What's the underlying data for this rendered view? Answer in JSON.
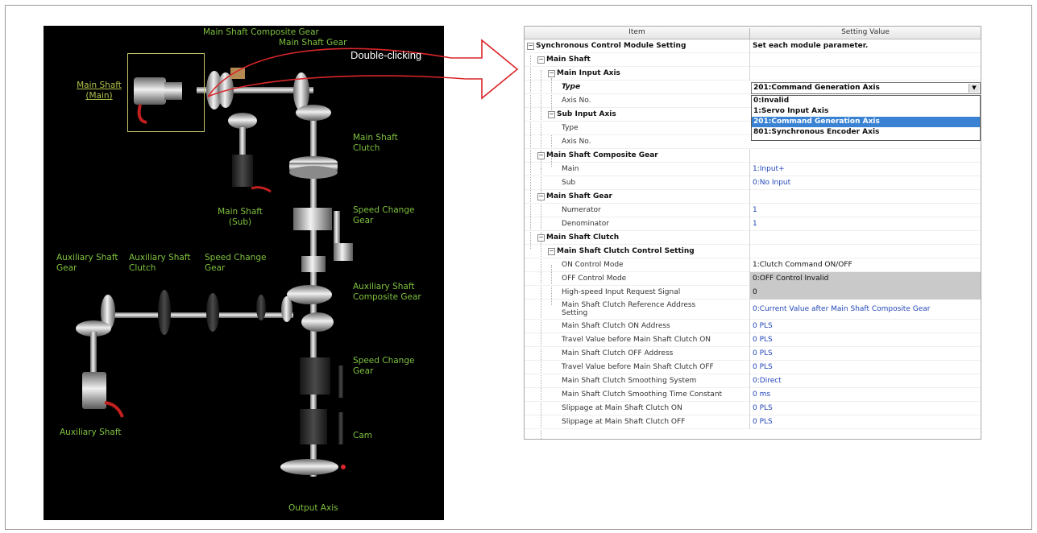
{
  "diagram": {
    "labels": {
      "main_shaft_composite_gear": "Main Shaft Composite Gear",
      "main_shaft_gear": "Main Shaft Gear",
      "main_shaft_main": "Main Shaft (Main)",
      "main_shaft_clutch": "Main Shaft Clutch",
      "main_shaft_sub": "Main Shaft (Sub)",
      "speed_change_gear_1": "Speed Change Gear",
      "auxiliary_shaft_gear": "Auxiliary Shaft Gear",
      "auxiliary_shaft_clutch": "Auxiliary Shaft Clutch",
      "speed_change_gear_aux": "Speed Change Gear",
      "auxiliary_shaft_composite_gear": "Auxiliary Shaft Composite Gear",
      "speed_change_gear_2": "Speed Change Gear",
      "auxiliary_shaft": "Auxiliary Shaft",
      "cam": "Cam",
      "output_axis": "Output Axis"
    },
    "colors": {
      "background": "#000000",
      "label": "#7fc23f",
      "arrow": "#d9262a"
    }
  },
  "callout": {
    "label": "Double-clicking"
  },
  "table": {
    "headers": {
      "item": "Item",
      "value": "Setting Value"
    },
    "rows": [
      {
        "item": "Synchronous Control Module Setting",
        "value": "Set each module parameter."
      },
      {
        "item": "Main Shaft",
        "value": ""
      },
      {
        "item": "Main Input Axis",
        "value": ""
      },
      {
        "item": "Type",
        "value": ""
      },
      {
        "item": "Axis No.",
        "value": ""
      },
      {
        "item": "Sub Input Axis",
        "value": ""
      },
      {
        "item": "Type",
        "value": ""
      },
      {
        "item": "Axis No.",
        "value": ""
      },
      {
        "item": "Main Shaft Composite Gear",
        "value": ""
      },
      {
        "item": "Main",
        "value": "1:Input+"
      },
      {
        "item": "Sub",
        "value": "0:No Input"
      },
      {
        "item": "Main Shaft Gear",
        "value": ""
      },
      {
        "item": "Numerator",
        "value": "1"
      },
      {
        "item": "Denominator",
        "value": "1"
      },
      {
        "item": "Main Shaft Clutch",
        "value": ""
      },
      {
        "item": "Main Shaft Clutch Control Setting",
        "value": ""
      },
      {
        "item": "ON Control Mode",
        "value": "1:Clutch Command ON/OFF"
      },
      {
        "item": "OFF Control Mode",
        "value": "0:OFF Control Invalid"
      },
      {
        "item": "High-speed Input Request Signal",
        "value": "0"
      },
      {
        "item": "Main Shaft Clutch Reference Address Setting",
        "value": "0:Current Value after Main Shaft Composite Gear"
      },
      {
        "item": "Main Shaft Clutch ON Address",
        "value": "0 PLS"
      },
      {
        "item": "Travel Value before Main Shaft Clutch ON",
        "value": "0 PLS"
      },
      {
        "item": "Main Shaft Clutch OFF Address",
        "value": "0 PLS"
      },
      {
        "item": "Travel Value before Main Shaft Clutch OFF",
        "value": "0 PLS"
      },
      {
        "item": "Main Shaft Clutch Smoothing System",
        "value": "0:Direct"
      },
      {
        "item": "Main Shaft Clutch Smoothing Time Constant",
        "value": "0 ms"
      },
      {
        "item": "Slippage at Main Shaft Clutch ON",
        "value": "0 PLS"
      },
      {
        "item": "Slippage at Main Shaft Clutch OFF",
        "value": "0 PLS"
      }
    ],
    "combo": {
      "value": "201:Command Generation Axis",
      "button": "▼"
    },
    "dropdown_options": [
      "0:Invalid",
      "1:Servo Input Axis",
      "201:Command Generation Axis",
      "801:Synchronous Encoder Axis"
    ],
    "toggle_glyph": "−",
    "colors": {
      "selected": "#3a83d4",
      "value_text": "#2346b8",
      "disabled": "#c9c9c9"
    }
  }
}
